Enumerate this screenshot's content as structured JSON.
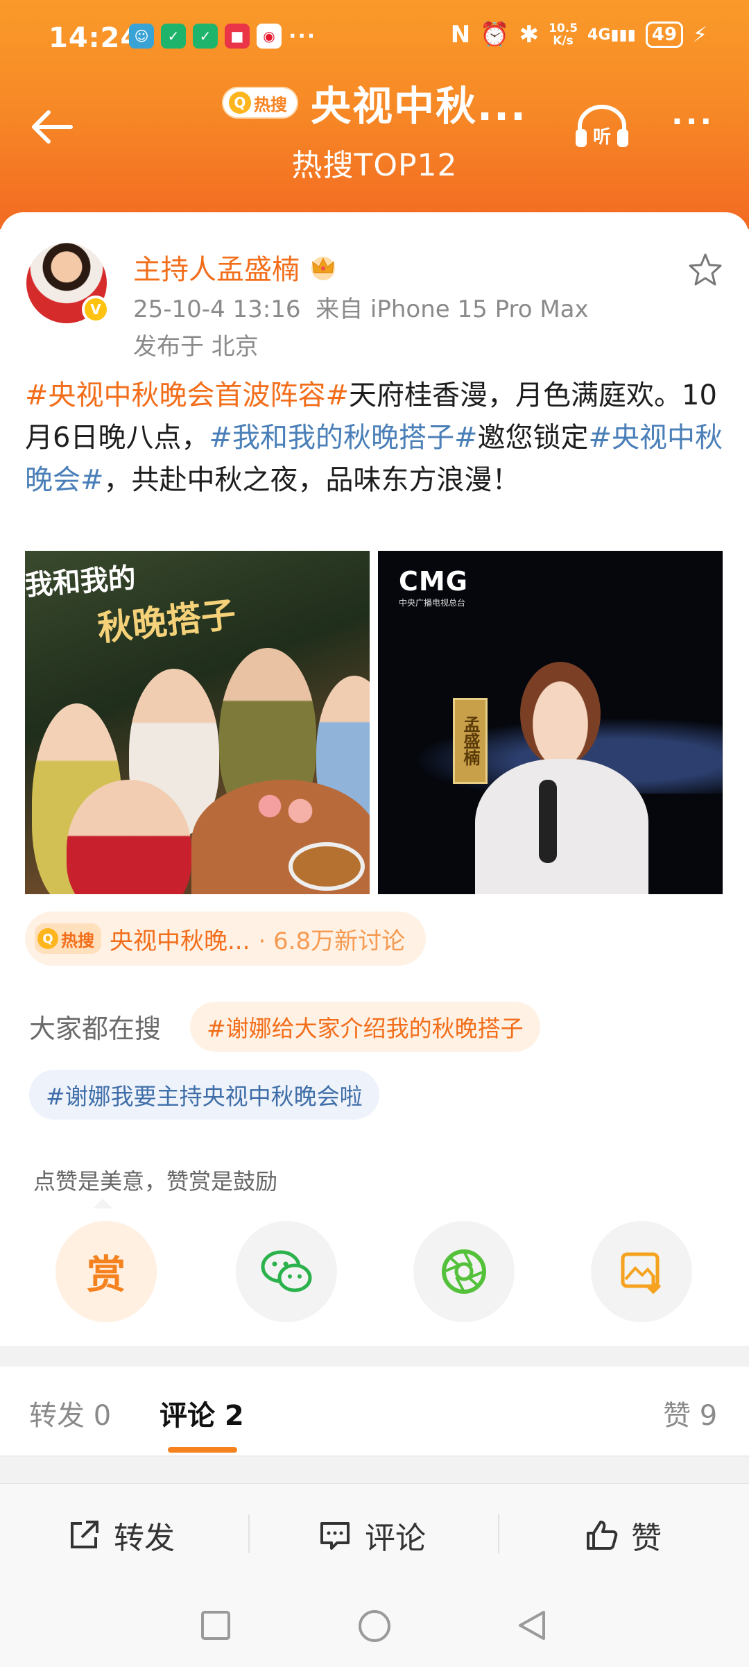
{
  "status_bar": {
    "time": "14:24",
    "net_speed_top": "10.5",
    "net_speed_bottom": "K/s",
    "signal": "4G",
    "battery": "49",
    "more": "···"
  },
  "header": {
    "badge_label": "热搜",
    "title": "央视中秋...",
    "subtitle": "热搜TOP12"
  },
  "post": {
    "author": "主持人孟盛楠",
    "time": "25-10-4 13:16",
    "source": "来自 iPhone 15 Pro Max",
    "location": "发布于 北京",
    "segments": [
      {
        "text": "#央视中秋晚会首波阵容#",
        "type": "tag-orange"
      },
      {
        "text": "天府桂香漫，月色满庭欢。10月6日晚八点，",
        "type": "plain"
      },
      {
        "text": "#我和我的秋晚搭子#",
        "type": "tag-blue"
      },
      {
        "text": "邀您锁定",
        "type": "plain"
      },
      {
        "text": "#央视中秋晚会#",
        "type": "tag-blue"
      },
      {
        "text": "，共赴中秋之夜，品味东方浪漫！",
        "type": "plain"
      }
    ],
    "image1": {
      "title_line1": "我和我的",
      "title_line2": "秋晚搭子"
    },
    "image2": {
      "logo": "CMG",
      "logo_sub": "中央广播电视总台",
      "nameplate": "孟盛楠"
    }
  },
  "hot_topic": {
    "badge": "热搜",
    "name": "央视中秋晚...",
    "count": "· 6.8万新讨论"
  },
  "searches": {
    "label": "大家都在搜",
    "items": [
      "#谢娜给大家介绍我的秋晚搭子",
      "#谢娜我要主持央视中秋晚会啦"
    ]
  },
  "reward": {
    "tip": "点赞是美意，赞赏是鼓励",
    "reward_label": "赏"
  },
  "tabs": {
    "repost": "转发 0",
    "comment": "评论 2",
    "like": "赞 9"
  },
  "bottom_bar": {
    "repost": "转发",
    "comment": "评论",
    "like": "赞"
  },
  "colors": {
    "brand_orange": "#f26e1b",
    "tag_blue": "#4a7fb8",
    "header_gradient_top": "#fa9a2a",
    "header_gradient_bottom": "#f26a22"
  }
}
